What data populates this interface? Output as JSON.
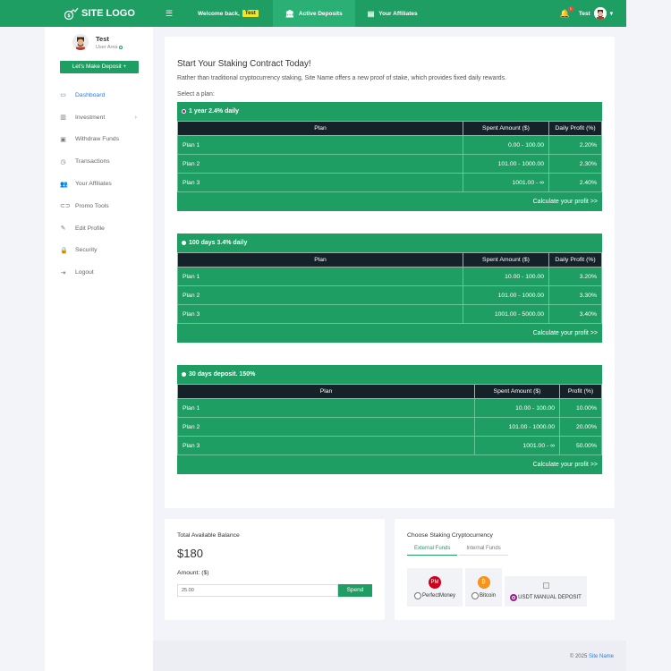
{
  "header": {
    "logo_text": "SITE LOGO",
    "welcome_text": "Welcome back,",
    "welcome_user": "Test",
    "nav": [
      {
        "label": "Active Deposits",
        "icon": "bank-icon"
      },
      {
        "label": "Your Affiliates",
        "icon": "building-icon"
      }
    ],
    "notifications_count": "1",
    "user_name": "Test"
  },
  "sidebar": {
    "profile_name": "Test",
    "profile_role": "User Area",
    "deposit_button": "Let's Make Deposit",
    "items": [
      {
        "label": "Dashboard",
        "icon": "monitor-icon",
        "active": true
      },
      {
        "label": "Investment",
        "icon": "bar-chart-icon",
        "has_submenu": true
      },
      {
        "label": "Withdraw Funds",
        "icon": "wallet-icon"
      },
      {
        "label": "Transactions",
        "icon": "history-icon"
      },
      {
        "label": "Your Affiliates",
        "icon": "users-icon"
      },
      {
        "label": "Promo Tools",
        "icon": "link-icon"
      },
      {
        "label": "Edit Profile",
        "icon": "pencil-icon"
      },
      {
        "label": "Security",
        "icon": "lock-icon"
      },
      {
        "label": "Logout",
        "icon": "logout-icon"
      }
    ]
  },
  "main": {
    "headline": "Start Your Staking Contract Today!",
    "intro": "Rather than traditional cryptocurrency staking, Site Name offers a new proof of stake, which provides fixed daily rewards.",
    "select_label": "Select a plan:",
    "plans": [
      {
        "title": "1 year 2.4% daily",
        "selected": true,
        "headers": [
          "Plan",
          "Spent Amount ($)",
          "Daily Profit (%)"
        ],
        "rows": [
          [
            "Plan 1",
            "0.00 - 100.00",
            "2.20%"
          ],
          [
            "Plan 2",
            "101.00 - 1000.00",
            "2.30%"
          ],
          [
            "Plan 3",
            "1001.00 - ∞",
            "2.40%"
          ]
        ],
        "calc_link": "Calculate your profit >>"
      },
      {
        "title": "100 days 3.4% daily",
        "selected": false,
        "headers": [
          "Plan",
          "Spent Amount ($)",
          "Daily Profit (%)"
        ],
        "rows": [
          [
            "Plan 1",
            "10.00 - 100.00",
            "3.20%"
          ],
          [
            "Plan 2",
            "101.00 - 1000.00",
            "3.30%"
          ],
          [
            "Plan 3",
            "1001.00 - 5000.00",
            "3.40%"
          ]
        ],
        "calc_link": "Calculate your profit >>"
      },
      {
        "title": "30 days deposit. 150%",
        "selected": false,
        "headers": [
          "Plan",
          "Spent Amount ($)",
          "Profit (%)"
        ],
        "rows": [
          [
            "Plan 1",
            "10.00 - 100.00",
            "10.00%"
          ],
          [
            "Plan 2",
            "101.00 - 1000.00",
            "20.00%"
          ],
          [
            "Plan 3",
            "1001.00 - ∞",
            "50.00%"
          ]
        ],
        "calc_link": "Calculate your profit >>"
      }
    ]
  },
  "balance": {
    "label": "Total Available Balance",
    "value": "$180",
    "amount_label": "Amount: ($)",
    "amount_value": "25.00",
    "spend_button": "Spend"
  },
  "crypto": {
    "title": "Choose Staking Cryptocurrency",
    "tabs": [
      {
        "label": "External Funds",
        "active": true
      },
      {
        "label": "Internal Funds",
        "active": false
      }
    ],
    "options": [
      {
        "label": "PerfectMoney",
        "icon_text": "PM",
        "color": "#d0021b",
        "checked": false
      },
      {
        "label": "Bitcoin",
        "icon_text": "₿",
        "color": "#f7931a",
        "checked": false
      },
      {
        "label": "USDT MANUAL DEPOSIT",
        "icon_text": "",
        "color": "",
        "checked": true
      }
    ]
  },
  "footer": {
    "copyright": "© 2025",
    "site_link": "Site Name"
  },
  "colors": {
    "primary": "#1f9e63",
    "table_header": "#16222a",
    "link": "#2e7be0"
  }
}
